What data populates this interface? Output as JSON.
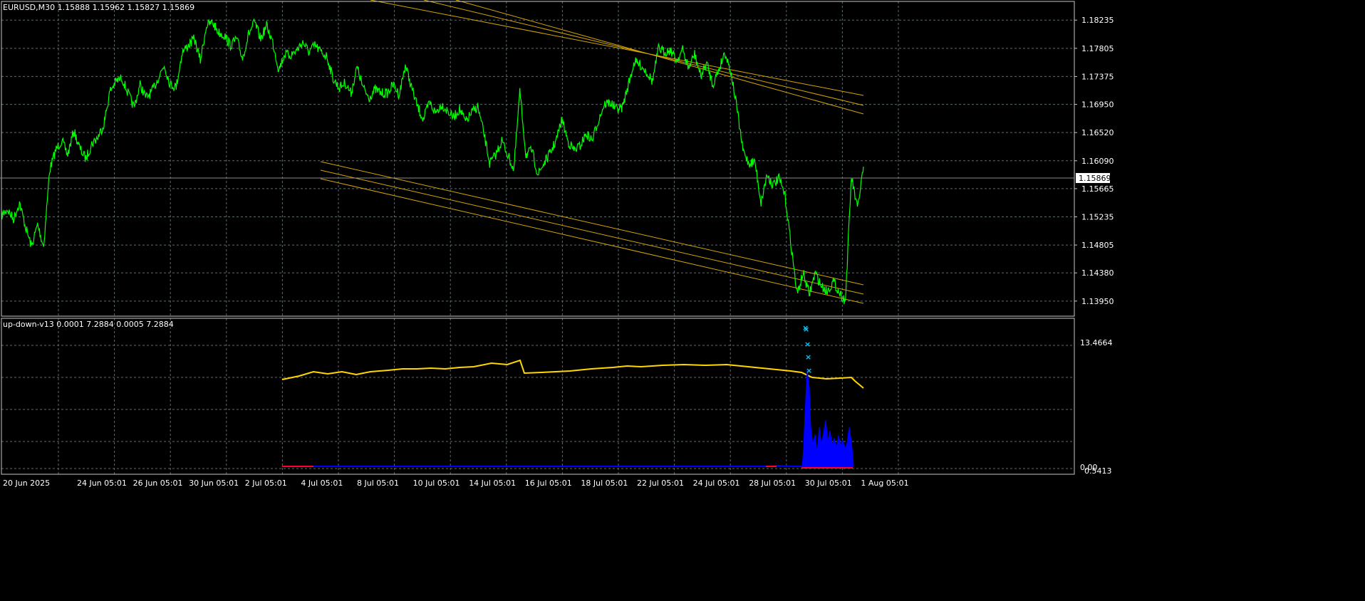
{
  "colors": {
    "background": "#000000",
    "grid": "#5f6b6b",
    "frame": "#c8c8c8",
    "price_line": "#00ff00",
    "channel": "#d4a500",
    "ask_line": "#8a8a8a",
    "indicator_yellow": "#ffd700",
    "indicator_blue": "#0000ff",
    "indicator_red": "#ff0033",
    "marker_cyan": "#00c8ff",
    "price_label_bg": "#ffffff",
    "text": "#ffffff"
  },
  "main_panel": {
    "header": "EURUSD,M30  1.15888 1.15962 1.15827 1.15869",
    "current_price_label": "1.15869"
  },
  "indicator_panel": {
    "header": "up-down-v13 0.0001 7.2884 0.0005 7.2884",
    "top_label": "13.4664",
    "zero_label": "0.00",
    "overlap_label": "0.5413"
  },
  "chart_data": [
    {
      "type": "line",
      "title": "EURUSD,M30",
      "ylim": [
        1.1372,
        1.1852
      ],
      "y_ticks": [
        "1.18235",
        "1.17805",
        "1.17375",
        "1.16950",
        "1.16520",
        "1.16090",
        "1.15665",
        "1.15235",
        "1.14805",
        "1.14380",
        "1.13950"
      ],
      "x_ticks": [
        "20 Jun 2025",
        "24 Jun 05:01",
        "26 Jun 05:01",
        "30 Jun 05:01",
        "2 Jul 05:01",
        "4 Jul 05:01",
        "8 Jul 05:01",
        "10 Jul 05:01",
        "14 Jul 05:01",
        "16 Jul 05:01",
        "18 Jul 05:01",
        "22 Jul 05:01",
        "24 Jul 05:01",
        "28 Jul 05:01",
        "30 Jul 05:01",
        "1 Aug 05:01"
      ],
      "last_price": 1.15869,
      "series": [
        {
          "values": [
            1.1525,
            1.1535,
            1.152,
            1.1545,
            1.1508,
            1.1478,
            1.1512,
            1.1478,
            1.1595,
            1.1625,
            1.164,
            1.1618,
            1.1655,
            1.1628,
            1.1612,
            1.1635,
            1.1645,
            1.1665,
            1.1715,
            1.173,
            1.1735,
            1.1712,
            1.169,
            1.1725,
            1.1705,
            1.1715,
            1.1735,
            1.1755,
            1.1725,
            1.1722,
            1.1775,
            1.1785,
            1.1795,
            1.1762,
            1.1815,
            1.182,
            1.1805,
            1.18,
            1.1785,
            1.1795,
            1.1765,
            1.1802,
            1.182,
            1.1795,
            1.1815,
            1.179,
            1.1748,
            1.1772,
            1.177,
            1.1778,
            1.179,
            1.1775,
            1.1785,
            1.1775,
            1.1768,
            1.1735,
            1.172,
            1.1728,
            1.1712,
            1.1752,
            1.172,
            1.1705,
            1.1718,
            1.1712,
            1.1712,
            1.1725,
            1.171,
            1.1755,
            1.1722,
            1.1692,
            1.1672,
            1.1698,
            1.1682,
            1.1695,
            1.1685,
            1.1675,
            1.1688,
            1.1668,
            1.1682,
            1.1692,
            1.1652,
            1.1605,
            1.1618,
            1.164,
            1.1618,
            1.1595,
            1.1715,
            1.1618,
            1.1625,
            1.1588,
            1.1605,
            1.162,
            1.164,
            1.1672,
            1.1638,
            1.1625,
            1.1632,
            1.165,
            1.164,
            1.167,
            1.1695,
            1.1698,
            1.1688,
            1.169,
            1.1725,
            1.176,
            1.1755,
            1.1745,
            1.173,
            1.178,
            1.1775,
            1.1778,
            1.1762,
            1.1778,
            1.175,
            1.1772,
            1.1738,
            1.1758,
            1.1725,
            1.1748,
            1.1775,
            1.1745,
            1.169,
            1.1625,
            1.1605,
            1.1608,
            1.1545,
            1.1588,
            1.1572,
            1.1582,
            1.1555,
            1.148,
            1.1405,
            1.1438,
            1.1405,
            1.1438,
            1.1418,
            1.141,
            1.1425,
            1.1408,
            1.1395,
            1.1585,
            1.1535,
            1.16
          ]
        }
      ],
      "channels": [
        {
          "name": "upper",
          "lines": [
            [
              [
                520,
                0
              ],
              [
                1212,
                134
              ]
            ],
            [
              [
                595,
                0
              ],
              [
                1212,
                148
              ]
            ],
            [
              [
                640,
                0
              ],
              [
                1212,
                160
              ]
            ]
          ]
        },
        {
          "name": "lower",
          "lines": [
            [
              [
                450,
                227
              ],
              [
                1212,
                400
              ]
            ],
            [
              [
                450,
                239
              ],
              [
                1212,
                413
              ]
            ],
            [
              [
                450,
                251
              ],
              [
                1212,
                426
              ]
            ]
          ]
        }
      ]
    },
    {
      "type": "area",
      "title": "up-down-v13",
      "ylim": [
        0,
        13.4664
      ],
      "series": [
        {
          "values": [
            [
              396,
              533
            ],
            [
              420,
              528
            ],
            [
              440,
              522
            ],
            [
              460,
              525
            ],
            [
              480,
              522
            ],
            [
              500,
              526
            ],
            [
              520,
              522
            ],
            [
              545,
              520
            ],
            [
              565,
              518
            ],
            [
              585,
              518
            ],
            [
              605,
              517
            ],
            [
              625,
              518
            ],
            [
              645,
              516
            ],
            [
              665,
              515
            ],
            [
              690,
              510
            ],
            [
              712,
              512
            ],
            [
              730,
              506
            ],
            [
              736,
              524
            ],
            [
              760,
              523
            ],
            [
              780,
              522
            ],
            [
              800,
              521
            ],
            [
              830,
              518
            ],
            [
              860,
              516
            ],
            [
              880,
              514
            ],
            [
              900,
              515
            ],
            [
              930,
              513
            ],
            [
              960,
              512
            ],
            [
              990,
              513
            ],
            [
              1020,
              512
            ],
            [
              1040,
              514
            ],
            [
              1060,
              516
            ],
            [
              1080,
              518
            ],
            [
              1100,
              520
            ],
            [
              1110,
              521
            ],
            [
              1125,
              523
            ],
            [
              1140,
              530
            ],
            [
              1160,
              532
            ],
            [
              1180,
              531
            ],
            [
              1195,
              530
            ],
            [
              1200,
              535
            ],
            [
              1212,
              545
            ]
          ]
        },
        {
          "values": [
            [
              1126,
              655
            ],
            [
              1128,
              630
            ],
            [
              1130,
              580
            ],
            [
              1133,
              520
            ],
            [
              1136,
              545
            ],
            [
              1138,
              600
            ],
            [
              1141,
              625
            ],
            [
              1144,
              610
            ],
            [
              1147,
              635
            ],
            [
              1150,
              600
            ],
            [
              1153,
              625
            ],
            [
              1156,
              608
            ],
            [
              1159,
              590
            ],
            [
              1162,
              620
            ],
            [
              1165,
              605
            ],
            [
              1168,
              625
            ],
            [
              1171,
              615
            ],
            [
              1174,
              630
            ],
            [
              1177,
              612
            ],
            [
              1180,
              625
            ],
            [
              1183,
              618
            ],
            [
              1186,
              630
            ],
            [
              1189,
              622
            ],
            [
              1192,
              600
            ],
            [
              1195,
              620
            ],
            [
              1197,
              640
            ],
            [
              1198,
              655
            ]
          ]
        },
        {
          "values": [
            [
              396,
              655
            ],
            [
              440,
              655
            ],
            [
              1075,
              655
            ],
            [
              1090,
              654
            ],
            [
              1115,
              655
            ],
            [
              1197,
              655
            ]
          ]
        }
      ],
      "markers": [
        [
          1130,
          460
        ],
        [
          1131,
          462
        ],
        [
          1133,
          483
        ],
        [
          1134,
          501
        ],
        [
          1135,
          520
        ]
      ]
    }
  ]
}
